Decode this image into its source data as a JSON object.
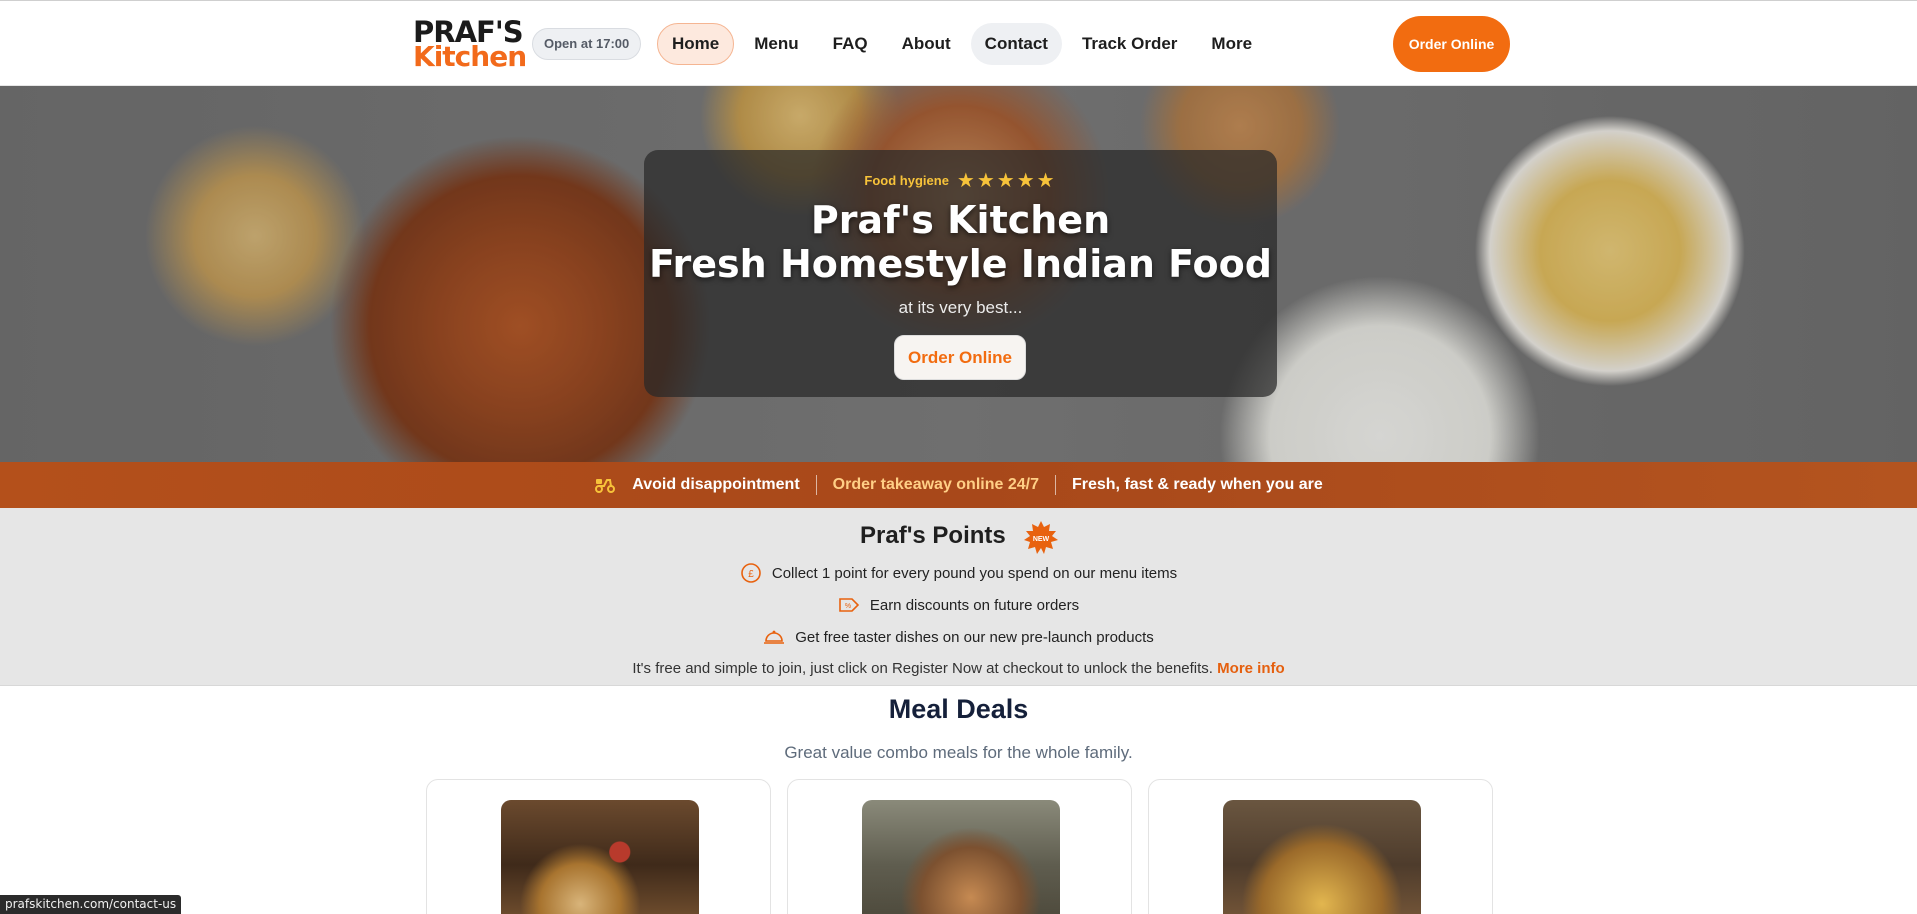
{
  "header": {
    "logo_line1": "PRAF'S",
    "logo_line2": "Kitchen",
    "open_status": "Open at 17:00",
    "nav": [
      {
        "label": "Home"
      },
      {
        "label": "Menu"
      },
      {
        "label": "FAQ"
      },
      {
        "label": "About"
      },
      {
        "label": "Contact"
      },
      {
        "label": "Track Order"
      },
      {
        "label": "More"
      }
    ],
    "order_button": "Order Online"
  },
  "hero": {
    "hygiene_label": "Food hygiene",
    "hygiene_stars": "★★★★★",
    "title_line1": "Praf's Kitchen",
    "title_line2": "Fresh Homestyle Indian Food",
    "subtitle": "at its very best...",
    "cta": "Order Online"
  },
  "strip": {
    "icon": "scooter-icon",
    "item1": "Avoid disappointment",
    "item2": "Order takeaway online 24/7",
    "item3": "Fresh, fast & ready when you are"
  },
  "points": {
    "title": "Praf's Points",
    "badge": "NEW",
    "items": [
      {
        "icon": "pound-coin-icon",
        "text": "Collect 1 point for every pound you spend on our menu items"
      },
      {
        "icon": "discount-tag-icon",
        "text": "Earn discounts on future orders"
      },
      {
        "icon": "cloche-icon",
        "text": "Get free taster dishes on our new pre-launch products"
      }
    ],
    "note": "It's free and simple to join, just click on Register Now at checkout to unlock the benefits.",
    "more_link": "More info"
  },
  "deals": {
    "title": "Meal Deals",
    "subtitle": "Great value combo meals for the whole family."
  },
  "status_bar": {
    "url": "prafskitchen.com/contact-us"
  },
  "colors": {
    "accent": "#f26c10",
    "strip": "#a8481a",
    "star": "#f7c33a"
  }
}
